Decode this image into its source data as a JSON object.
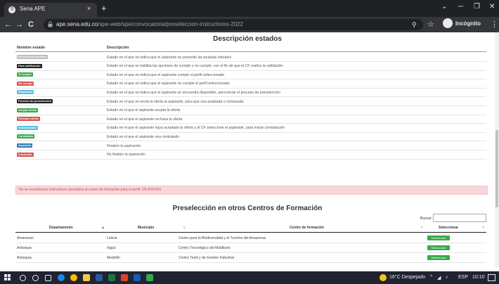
{
  "browser": {
    "tab_title": "Sena APE",
    "tab_close": "×",
    "new_tab": "+",
    "url_host": "ape.sena.edu.co",
    "url_path": "/spe-web/spe/convocatoria/preseleccion-instructores-2022",
    "mode_label": "Incógnito",
    "controls": {
      "minimize": "─",
      "maximize": "❐",
      "close": "✕",
      "back": "←",
      "forward": "→",
      "reload": "C",
      "zoom": "⚲",
      "star": "☆",
      "menu": "⋮"
    }
  },
  "estados": {
    "title": "Descripción estados",
    "col_name": "Nombre estado",
    "col_desc": "Descripción",
    "rows": [
      {
        "name": "No presentó pruebas",
        "color": "#bdbdbd",
        "desc": "Estado en el que se indica que el aspirante no presentó las pruebas virtuales"
      },
      {
        "name": "Para calificación",
        "color": "#222222",
        "desc": "Estado en el que se habilita las opciones de cumple y no cumple, con el fin de que el CF realice la validación"
      },
      {
        "name": "Si cumple",
        "color": "#39a94b",
        "desc": "Estado en el que se indica que el aspirante cumple el perfil seleccionado"
      },
      {
        "name": "No cumple",
        "color": "#d9534f",
        "desc": "Estado en el que se indica que el aspirante no cumple el perfil seleccionado"
      },
      {
        "name": "Disponible",
        "color": "#5bc0de",
        "desc": "Estado en el que se indica que el aspirante se encuentra disponible, para iniciar el proceso de preselección"
      },
      {
        "name": "Proceso de preselección",
        "color": "#222222",
        "desc": "Estado en el que se envía la oferta al aspirante, para que sea aceptada o rechazada"
      },
      {
        "name": "Aceptó oferta",
        "color": "#39a94b",
        "desc": "Estado en el que el aspirante acepta la oferta"
      },
      {
        "name": "Rechazó oferta",
        "color": "#d9534f",
        "desc": "Estado en el que el aspirante rechaza la oferta"
      },
      {
        "name": "Seleccionado",
        "color": "#5bc0de",
        "desc": "Estado en el que el aspirante haya aceptado la oferta y el CF seleccione el aspirante, para iniciar contratación"
      },
      {
        "name": "Contratado",
        "color": "#39a94b",
        "desc": "Estado en el que el aspirante sea contratado"
      },
      {
        "name": "Aspirante",
        "color": "#337ab7",
        "desc": "Finalizo la aspiración"
      },
      {
        "name": "Inactivado",
        "color": "#d9534f",
        "desc": "No finalizo la aspiración"
      }
    ]
  },
  "alert": {
    "text": "No se encontraron instructores asociados al centro de formación para el perfil: CR-INSTRU"
  },
  "otros": {
    "title": "Preselección en otros Centros de Formación",
    "search_label": "Buscar:",
    "search_value": "",
    "columns": {
      "departamento": "Departamento",
      "municipio": "Municipio",
      "centro": "Centro de formación",
      "seleccionar": "Seleccionar"
    },
    "sort_up": "▲",
    "sort_both": "⇅",
    "rows": [
      {
        "departamento": "Amazonas",
        "municipio": "Leticia",
        "centro": "Centro para la Biodiversidad y el Turismo del Amazonas",
        "button": "Seleccionar"
      },
      {
        "departamento": "Antioquia",
        "municipio": "Itagüí",
        "centro": "Centro Tecnológico del Mobiliario",
        "button": "Seleccionar"
      },
      {
        "departamento": "Antioquia",
        "municipio": "Medellín",
        "centro": "Centro Textil y de Gestión Industrial",
        "button": "Seleccionar"
      }
    ]
  },
  "taskbar": {
    "weather": "16°C Despejado",
    "language": "ESP",
    "time": "10:10",
    "tray_up": "^"
  }
}
